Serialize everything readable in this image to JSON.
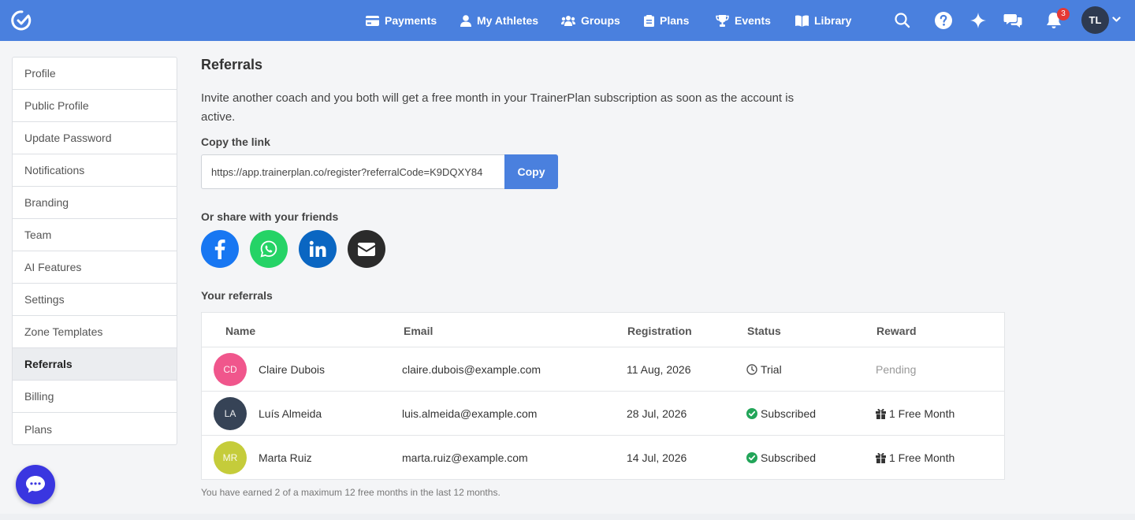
{
  "brand_color": "#4a80de",
  "nav": {
    "items": [
      {
        "label": "Payments",
        "icon": "payments-icon"
      },
      {
        "label": "My Athletes",
        "icon": "athlete-icon"
      },
      {
        "label": "Groups",
        "icon": "groups-icon"
      },
      {
        "label": "Plans",
        "icon": "plans-icon"
      },
      {
        "label": "Events",
        "icon": "trophy-icon"
      },
      {
        "label": "Library",
        "icon": "library-icon"
      }
    ],
    "notification_count": "3",
    "user_initials": "TL"
  },
  "sidebar": {
    "items": [
      {
        "label": "Profile"
      },
      {
        "label": "Public Profile"
      },
      {
        "label": "Update Password"
      },
      {
        "label": "Notifications"
      },
      {
        "label": "Branding"
      },
      {
        "label": "Team"
      },
      {
        "label": "AI Features"
      },
      {
        "label": "Settings"
      },
      {
        "label": "Zone Templates"
      },
      {
        "label": "Referrals",
        "active": true
      },
      {
        "label": "Billing"
      },
      {
        "label": "Plans"
      }
    ]
  },
  "main": {
    "title": "Referrals",
    "intro": "Invite another coach and you both will get a free month in your TrainerPlan subscription as soon as the account is active.",
    "copy_label": "Copy the link",
    "link_value": "https://app.trainerplan.co/register?referralCode=K9DQXY84",
    "copy_button": "Copy",
    "share_label": "Or share with your friends",
    "share": [
      {
        "name": "facebook",
        "color": "#1877f2"
      },
      {
        "name": "whatsapp",
        "color": "#25d366"
      },
      {
        "name": "linkedin",
        "color": "#0a66c2"
      },
      {
        "name": "email",
        "color": "#2b2b2b"
      }
    ],
    "referrals_label": "Your referrals",
    "table": {
      "headers": [
        "Name",
        "Email",
        "Registration",
        "Status",
        "Reward"
      ],
      "rows": [
        {
          "initials": "CD",
          "avatar_color": "#f0568c",
          "name": "Claire Dubois",
          "email": "claire.dubois@example.com",
          "registration": "11 Aug, 2026",
          "status": "Trial",
          "status_icon": "clock-icon",
          "reward": "Pending",
          "reward_icon": ""
        },
        {
          "initials": "LA",
          "avatar_color": "#364356",
          "name": "Luís Almeida",
          "email": "luis.almeida@example.com",
          "registration": "28 Jul, 2026",
          "status": "Subscribed",
          "status_icon": "check-circle-icon",
          "reward": "1 Free Month",
          "reward_icon": "gift-icon"
        },
        {
          "initials": "MR",
          "avatar_color": "#c5cc3a",
          "name": "Marta Ruiz",
          "email": "marta.ruiz@example.com",
          "registration": "14 Jul, 2026",
          "status": "Subscribed",
          "status_icon": "check-circle-icon",
          "reward": "1 Free Month",
          "reward_icon": "gift-icon"
        }
      ]
    },
    "footnote": "You have earned 2 of a maximum 12 free months in the last 12 months."
  }
}
